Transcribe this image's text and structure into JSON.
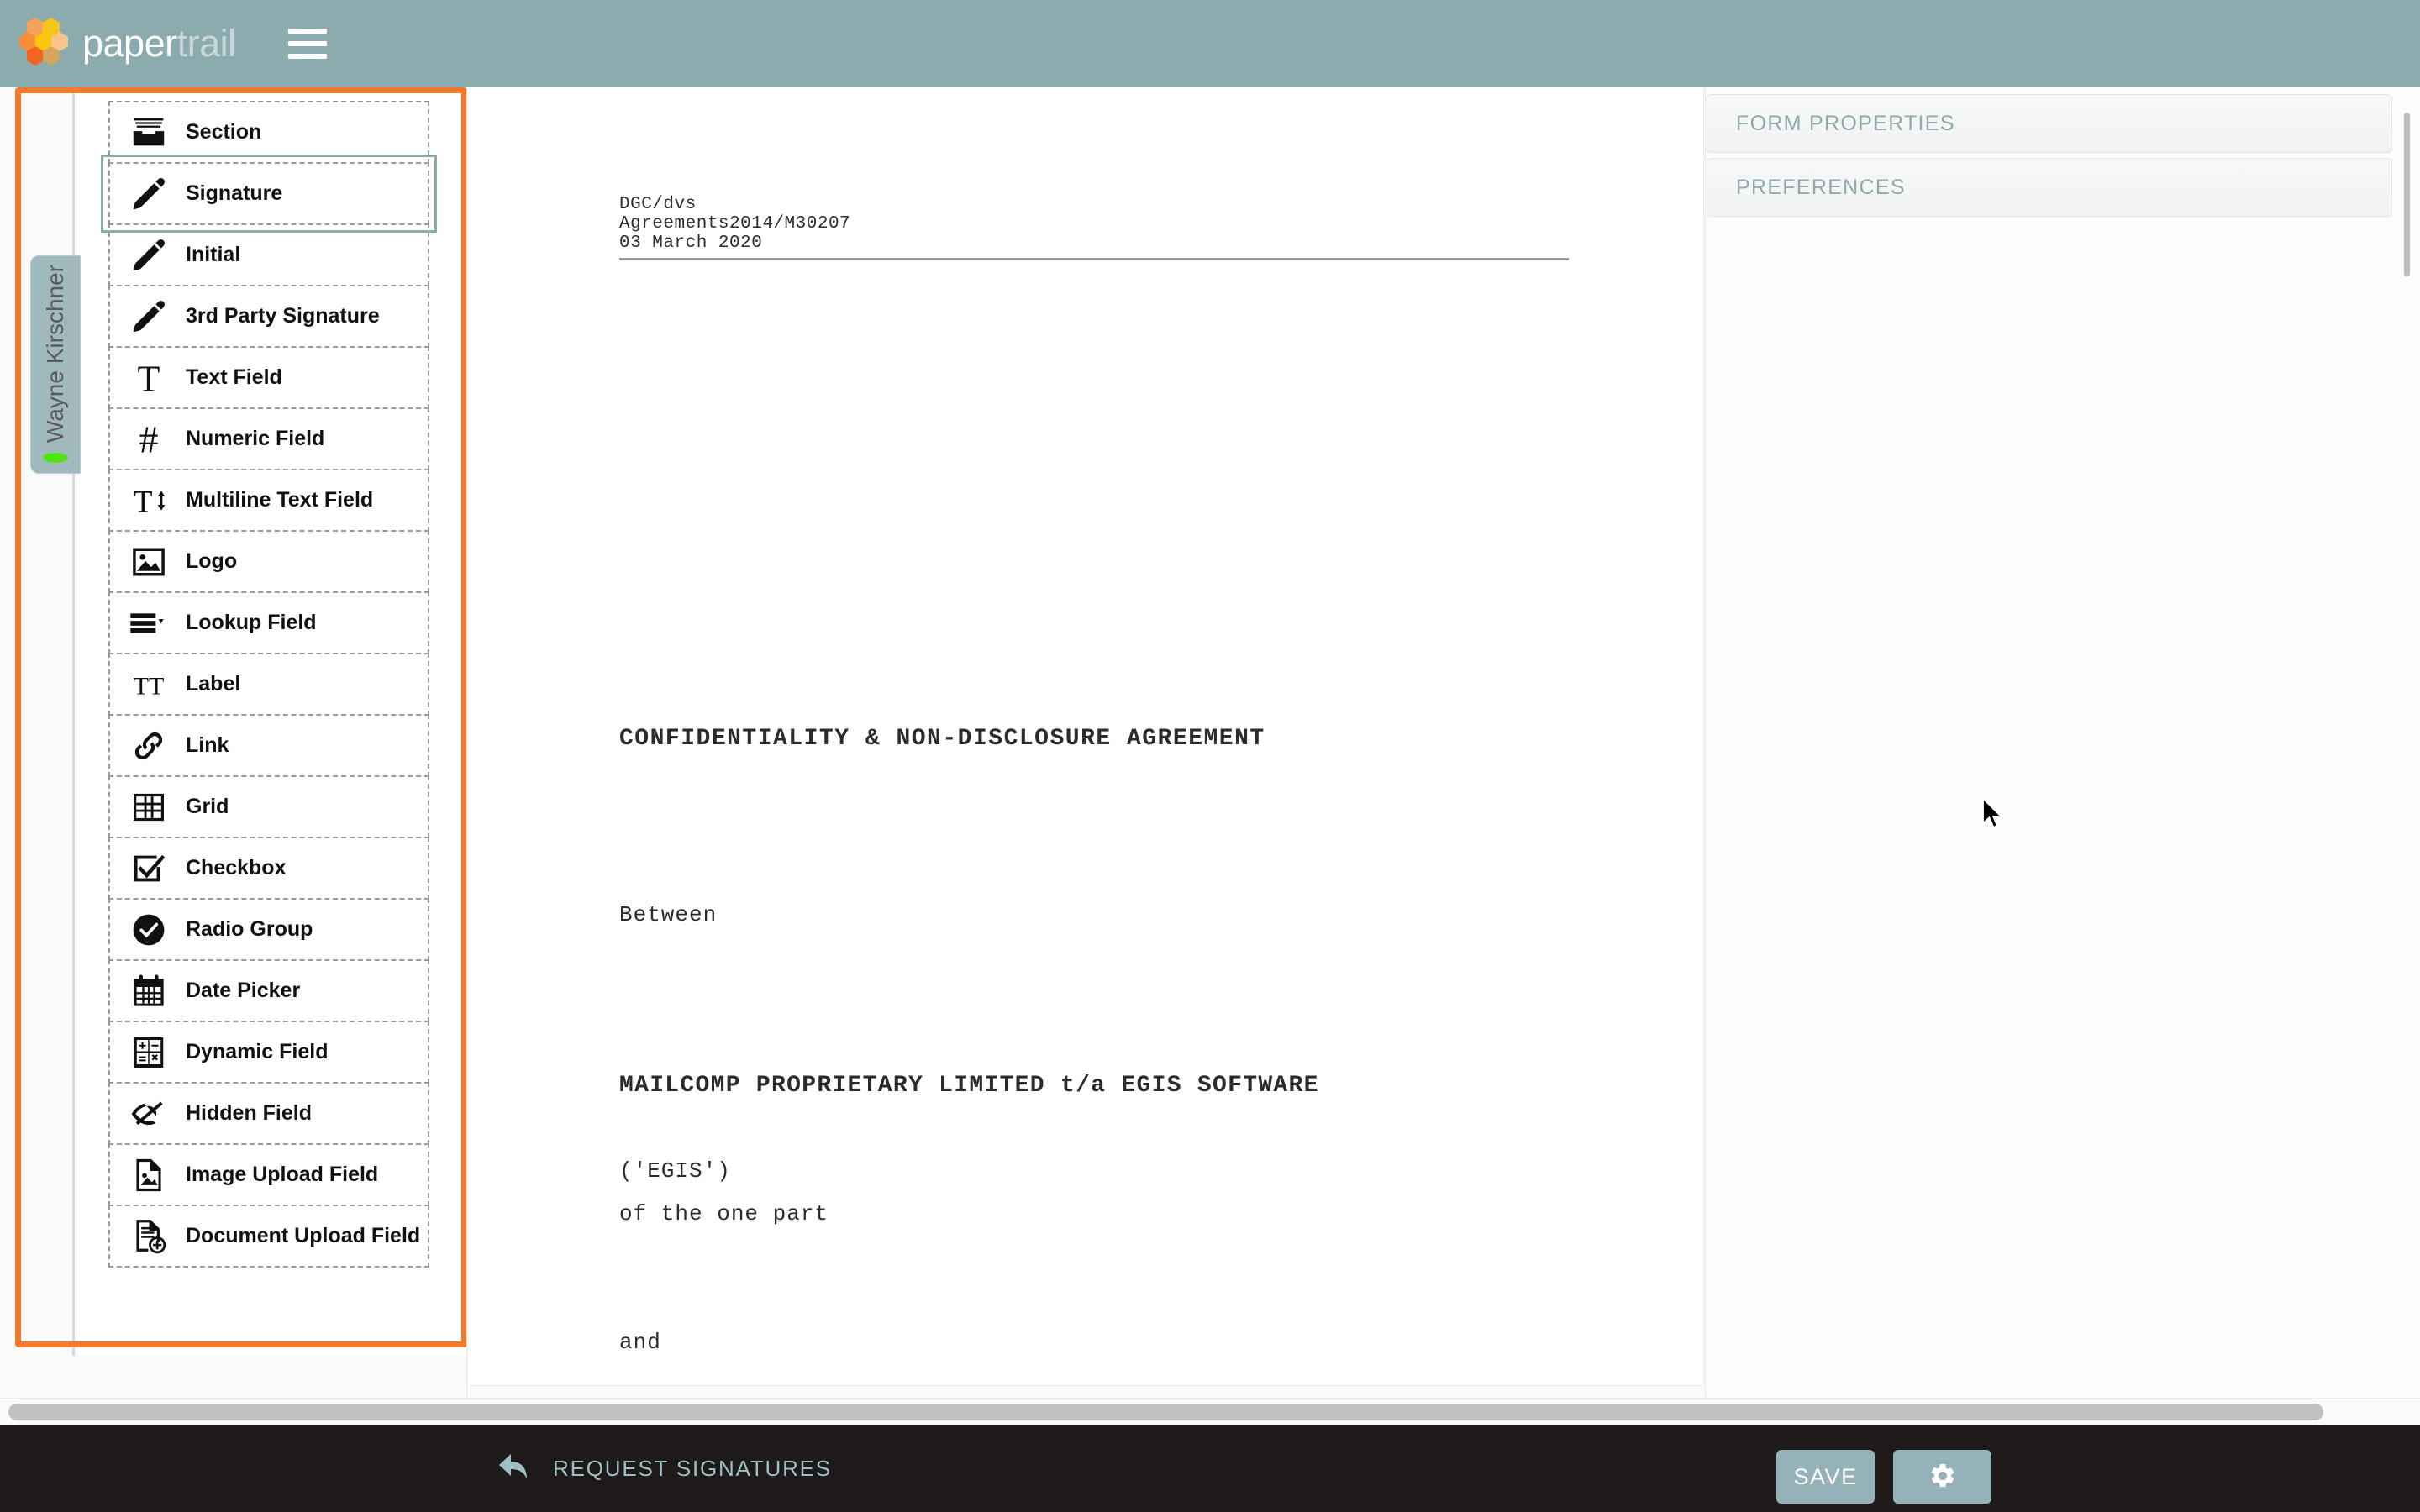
{
  "header": {
    "brand_primary": "paper",
    "brand_secondary": "trail",
    "menu_icon": "hamburger-icon",
    "bg_color": "#8cabaf"
  },
  "left_panel": {
    "highlight_color": "#f4792b",
    "user_tab": {
      "name": "Wayne Kirschner",
      "status_color": "#4ee414",
      "status": "online"
    },
    "tools": [
      {
        "label": "Section",
        "icon": "section-icon"
      },
      {
        "label": "Signature",
        "icon": "pencil-icon",
        "selected": true
      },
      {
        "label": "Initial",
        "icon": "pencil-icon"
      },
      {
        "label": "3rd Party Signature",
        "icon": "pencil-icon"
      },
      {
        "label": "Text Field",
        "icon": "text-t-icon"
      },
      {
        "label": "Numeric Field",
        "icon": "hash-icon"
      },
      {
        "label": "Multiline Text Field",
        "icon": "text-multiline-icon"
      },
      {
        "label": "Logo",
        "icon": "image-icon"
      },
      {
        "label": "Lookup Field",
        "icon": "lookup-list-icon"
      },
      {
        "label": "Label",
        "icon": "double-t-icon"
      },
      {
        "label": "Link",
        "icon": "link-chain-icon"
      },
      {
        "label": "Grid",
        "icon": "grid-table-icon"
      },
      {
        "label": "Checkbox",
        "icon": "checkbox-icon"
      },
      {
        "label": "Radio Group",
        "icon": "radio-check-circle-icon"
      },
      {
        "label": "Date Picker",
        "icon": "calendar-icon"
      },
      {
        "label": "Dynamic Field",
        "icon": "calculator-icon"
      },
      {
        "label": "Hidden Field",
        "icon": "eye-slash-icon"
      },
      {
        "label": "Image Upload Field",
        "icon": "image-file-icon"
      },
      {
        "label": "Document Upload Field",
        "icon": "document-plus-icon"
      }
    ]
  },
  "document": {
    "ref_line1": "DGC/dvs",
    "ref_line2": "Agreements2014/M30207",
    "ref_line3": "03 March 2020",
    "title": "CONFIDENTIALITY & NON-DISCLOSURE AGREEMENT",
    "between": "Between",
    "party_one": "MAILCOMP PROPRIETARY LIMITED t/a EGIS SOFTWARE",
    "party_one_alias": "('EGIS')",
    "party_one_role": "of the one part",
    "conjunction": "and"
  },
  "right_panel": {
    "sections": [
      {
        "label": "FORM PROPERTIES"
      },
      {
        "label": "PREFERENCES"
      }
    ]
  },
  "bottom_bar": {
    "request_signatures_label": "REQUEST SIGNATURES",
    "back_icon": "reply-arrow-icon",
    "save_label": "SAVE",
    "settings_icon": "gear-icon",
    "button_color": "#94b2b7",
    "bg_color": "#1e1a19"
  }
}
